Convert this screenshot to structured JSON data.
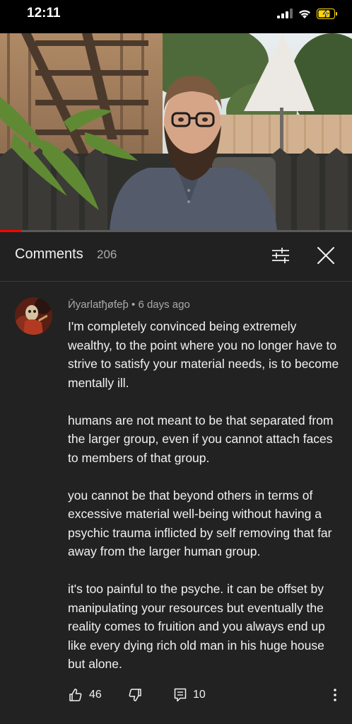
{
  "status_bar": {
    "time": "12:11",
    "icons": [
      "signal-icon",
      "wifi-icon",
      "battery-charging-icon"
    ]
  },
  "video": {
    "progress_fraction": 0.06,
    "progress_color": "#ff0000"
  },
  "comments_header": {
    "title": "Comments",
    "count": "206",
    "icons": [
      "filter-icon",
      "close-icon"
    ]
  },
  "comment": {
    "author": "Ӣyarlatђøƭeƥ",
    "separator": "•",
    "time_ago": "6 days ago",
    "paragraphs": [
      "I'm completely convinced being extremely wealthy, to the point where you no longer have to strive to satisfy your material needs, is to become mentally ill.",
      "humans are not meant to be that separated from the larger group, even if you cannot attach faces to members of that group.",
      "you cannot be that beyond others in terms of excessive material well-being without having a psychic trauma inflicted by self removing that far away from the larger human group.",
      "it's too painful to the psyche. it can be offset by manipulating your resources but eventually the reality comes to fruition and you always end up like every dying rich old man in his huge house but alone."
    ],
    "likes": "46",
    "replies": "10",
    "action_icons": [
      "thumbs-up-icon",
      "thumbs-down-icon",
      "reply-icon",
      "more-vert-icon"
    ]
  },
  "colors": {
    "background": "#222222",
    "header_background": "#212121",
    "primary_text": "#f1f1f1",
    "secondary_text": "#aaaaaa",
    "battery_charging": "#ffd60a"
  }
}
